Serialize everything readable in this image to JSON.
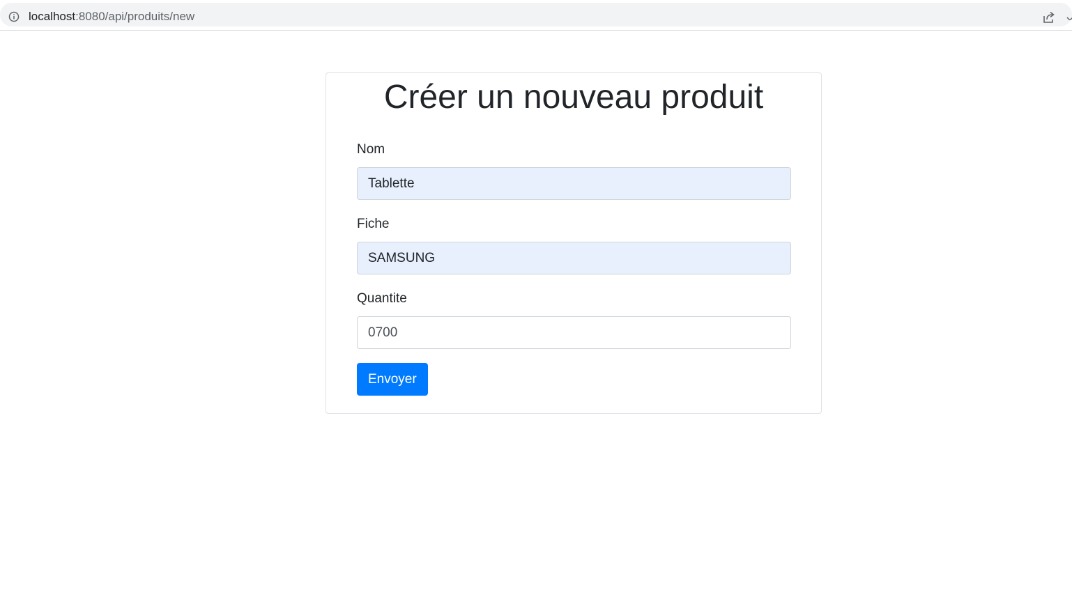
{
  "browser": {
    "url_host": "localhost",
    "url_rest": ":8080/api/produits/new"
  },
  "form": {
    "title": "Créer un nouveau produit",
    "fields": [
      {
        "label": "Nom",
        "value": "Tablette"
      },
      {
        "label": "Fiche",
        "value": "SAMSUNG"
      },
      {
        "label": "Quantite",
        "value": "0700"
      }
    ],
    "submit_label": "Envoyer"
  },
  "colors": {
    "primary": "#007bff",
    "autofill_background": "#e8f0fe",
    "card_border": "#dee2e6",
    "input_border": "#ced4da"
  },
  "icons": {
    "info": "info-icon",
    "share": "share-icon"
  }
}
